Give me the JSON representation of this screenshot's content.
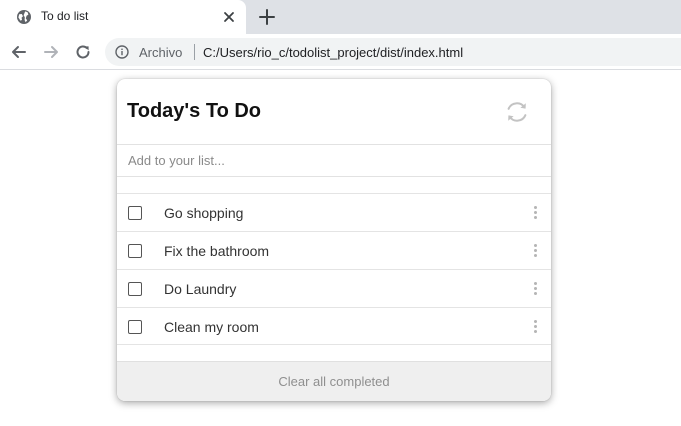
{
  "browser": {
    "tab": {
      "title": "To do list",
      "favicon": "globe-icon",
      "close_icon": "close-icon"
    },
    "new_tab_icon": "plus-icon",
    "nav": {
      "back": "back-arrow-icon",
      "forward": "forward-arrow-icon",
      "reload": "reload-icon"
    },
    "omnibox": {
      "info_icon": "info-icon",
      "site_label": "Archivo",
      "url": "C:/Users/rio_c/todolist_project/dist/index.html"
    }
  },
  "app": {
    "title": "Today's To Do",
    "refresh_icon": "refresh-icon",
    "input": {
      "placeholder": "Add to your list...",
      "value": ""
    },
    "items": [
      {
        "label": "Go shopping",
        "checked": false
      },
      {
        "label": "Fix the bathroom",
        "checked": false
      },
      {
        "label": "Do Laundry",
        "checked": false
      },
      {
        "label": "Clean my room",
        "checked": false
      }
    ],
    "footer_label": "Clear all completed"
  }
}
